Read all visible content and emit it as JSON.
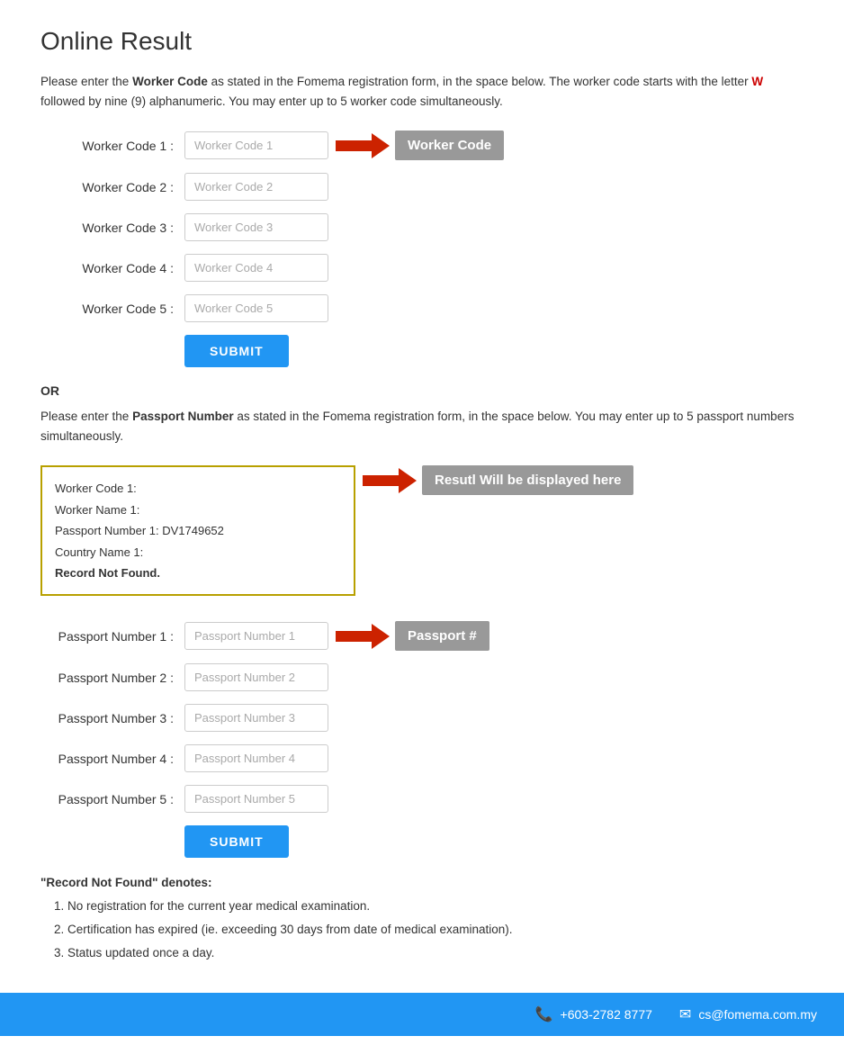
{
  "page": {
    "title": "Online Result",
    "intro_worker": "Please enter the ",
    "intro_worker_bold": "Worker Code",
    "intro_worker_rest": " as stated in the Fomema registration form, in the space below. The worker code starts with the letter ",
    "intro_worker_w": "W",
    "intro_worker_end": " followed by nine (9) alphanumeric. You may enter up to 5 worker code simultaneously.",
    "or_label": "OR",
    "intro_passport": "Please enter the ",
    "intro_passport_bold": "Passport Number",
    "intro_passport_rest": " as stated in the Fomema registration form, in the space below. You may enter up to 5 passport numbers simultaneously.",
    "worker_code_annotation": "Worker Code",
    "passport_annotation": "Passport #",
    "result_annotation": "Resutl Will be displayed here",
    "submit_label": "SUBMIT",
    "worker_fields": [
      {
        "label": "Worker Code 1 :",
        "placeholder": "Worker Code 1"
      },
      {
        "label": "Worker Code 2 :",
        "placeholder": "Worker Code 2"
      },
      {
        "label": "Worker Code 3 :",
        "placeholder": "Worker Code 3"
      },
      {
        "label": "Worker Code 4 :",
        "placeholder": "Worker Code 4"
      },
      {
        "label": "Worker Code 5 :",
        "placeholder": "Worker Code 5"
      }
    ],
    "passport_fields": [
      {
        "label": "Passport Number 1 :",
        "placeholder": "Passport Number 1"
      },
      {
        "label": "Passport Number 2 :",
        "placeholder": "Passport Number 2"
      },
      {
        "label": "Passport Number 3 :",
        "placeholder": "Passport Number 3"
      },
      {
        "label": "Passport Number 4 :",
        "placeholder": "Passport Number 4"
      },
      {
        "label": "Passport Number 5 :",
        "placeholder": "Passport Number 5"
      }
    ],
    "result_box": {
      "line1": "Worker Code 1:",
      "line2": "Worker Name 1:",
      "line3": "Passport Number 1: DV1749652",
      "line4": "Country Name 1:",
      "line5": "Record Not Found."
    },
    "notes": {
      "heading": "\"Record Not Found\" denotes:",
      "items": [
        "No registration for the current year medical examination.",
        "Certification has expired (ie. exceeding 30 days from date of medical examination).",
        "Status updated once a day."
      ]
    },
    "footer": {
      "phone_icon": "📞",
      "phone": "+603-2782 8777",
      "email_icon": "✉",
      "email": "cs@fomema.com.my"
    }
  }
}
